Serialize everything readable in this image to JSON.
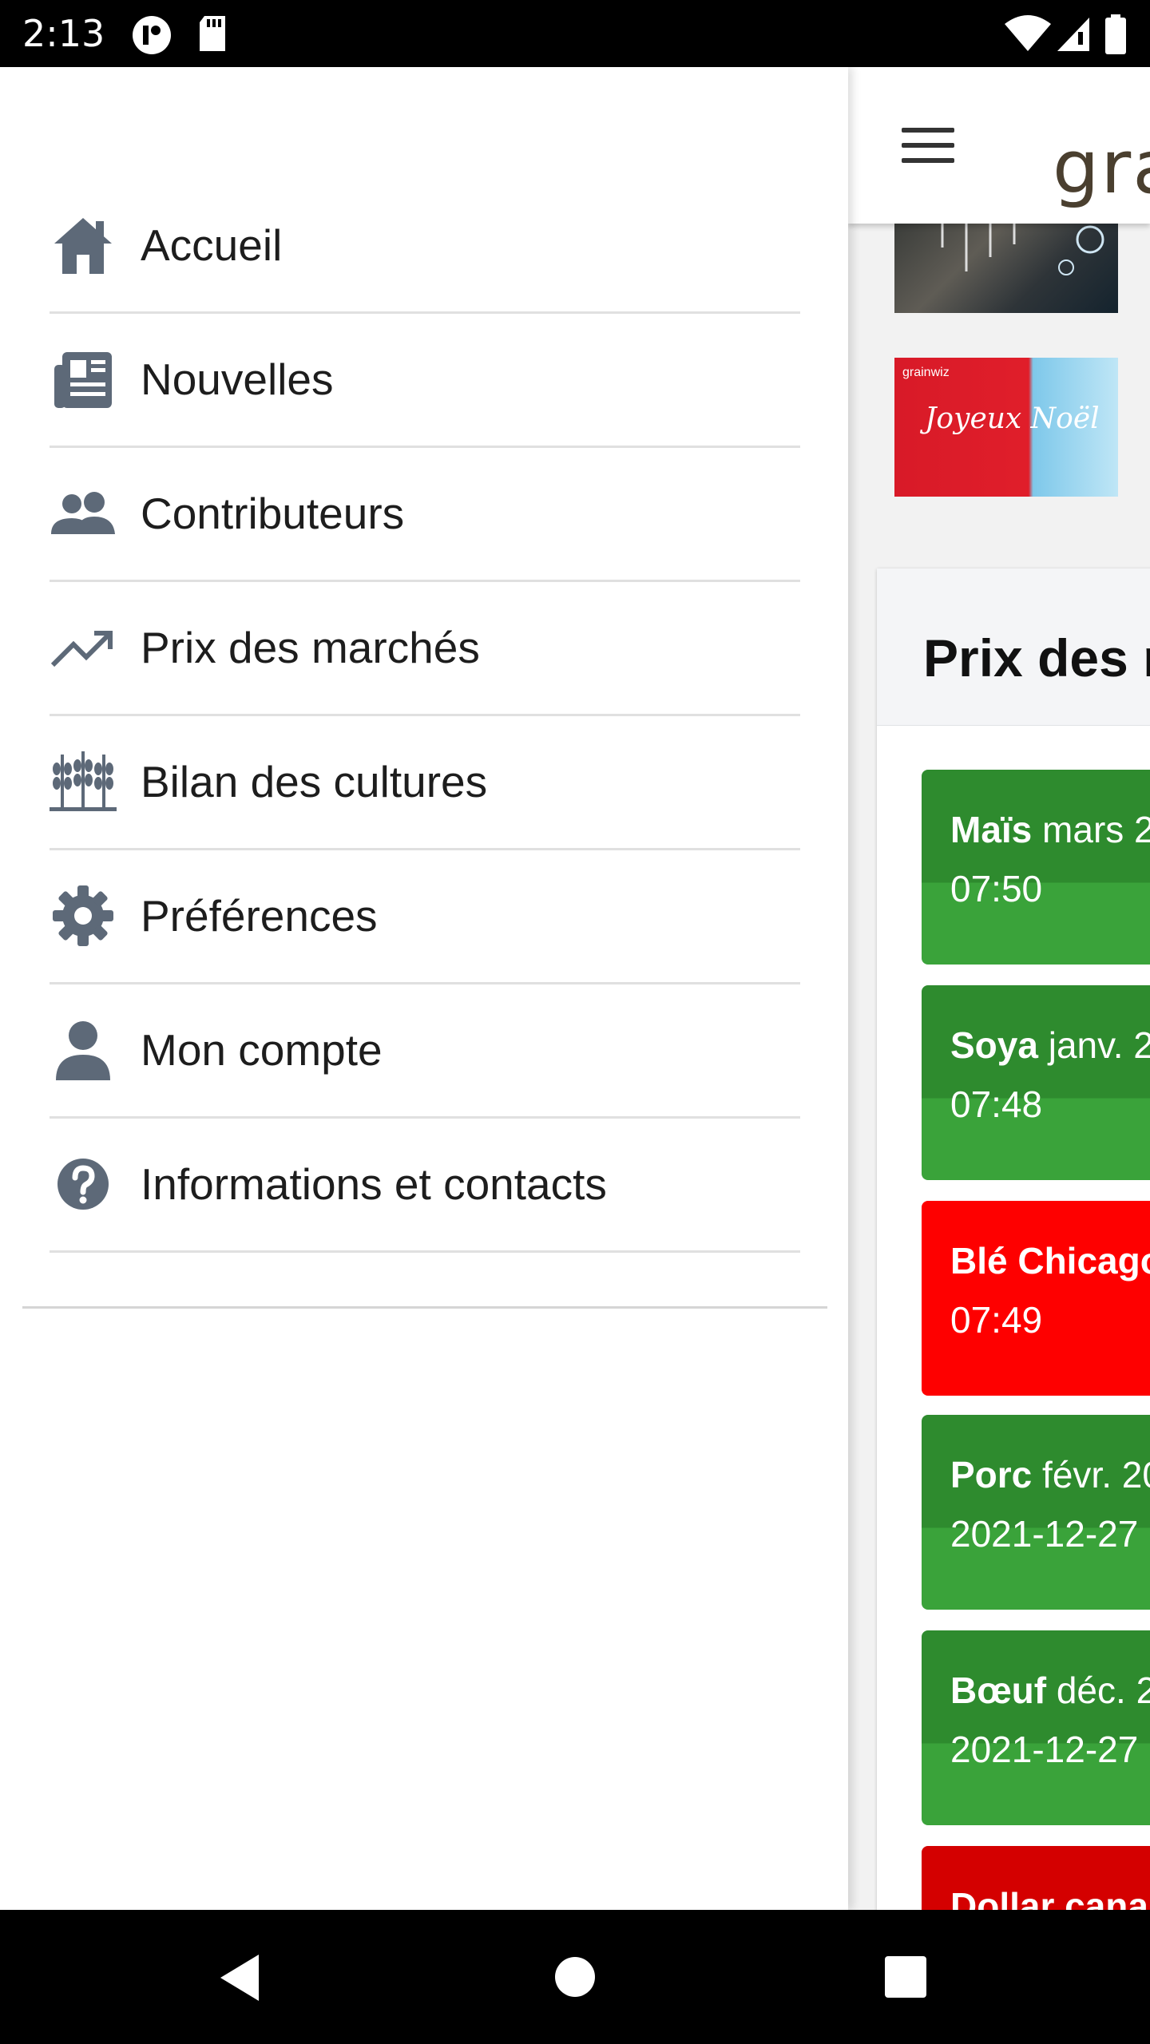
{
  "status_bar": {
    "time": "2:13"
  },
  "app": {
    "brand": "gra",
    "banner_small_text": "grainwiz",
    "banner_greeting": "Joyeux Noël",
    "prices_title": "Prix des r",
    "price_items": [
      {
        "name": "Maïs",
        "detail": "mars 2",
        "time": "07:50",
        "color": "green"
      },
      {
        "name": "Soya",
        "detail": "janv. 2",
        "time": "07:48",
        "color": "green"
      },
      {
        "name": "Blé Chicago",
        "detail": "",
        "time": "07:49",
        "color": "red"
      },
      {
        "name": "Porc",
        "detail": "févr. 20",
        "time": "2021-12-27",
        "color": "green"
      },
      {
        "name": "Bœuf",
        "detail": "déc. 2",
        "time": "2021-12-27",
        "color": "green"
      },
      {
        "name": "Dollar cana",
        "detail": "",
        "time": "",
        "color": "darkred"
      }
    ]
  },
  "drawer": {
    "items": [
      {
        "label": "Accueil",
        "icon": "home-icon"
      },
      {
        "label": "Nouvelles",
        "icon": "newspaper-icon"
      },
      {
        "label": "Contributeurs",
        "icon": "users-icon"
      },
      {
        "label": "Prix des marchés",
        "icon": "trending-up-icon"
      },
      {
        "label": "Bilan des cultures",
        "icon": "wheat-icon"
      },
      {
        "label": "Préférences",
        "icon": "gear-icon"
      },
      {
        "label": "Mon compte",
        "icon": "user-icon"
      },
      {
        "label": "Informations et contacts",
        "icon": "help-icon"
      }
    ]
  },
  "colors": {
    "icon": "#5d6978",
    "green": "#2e8b2e",
    "red": "#fe0000",
    "dark_red": "#d40000"
  }
}
